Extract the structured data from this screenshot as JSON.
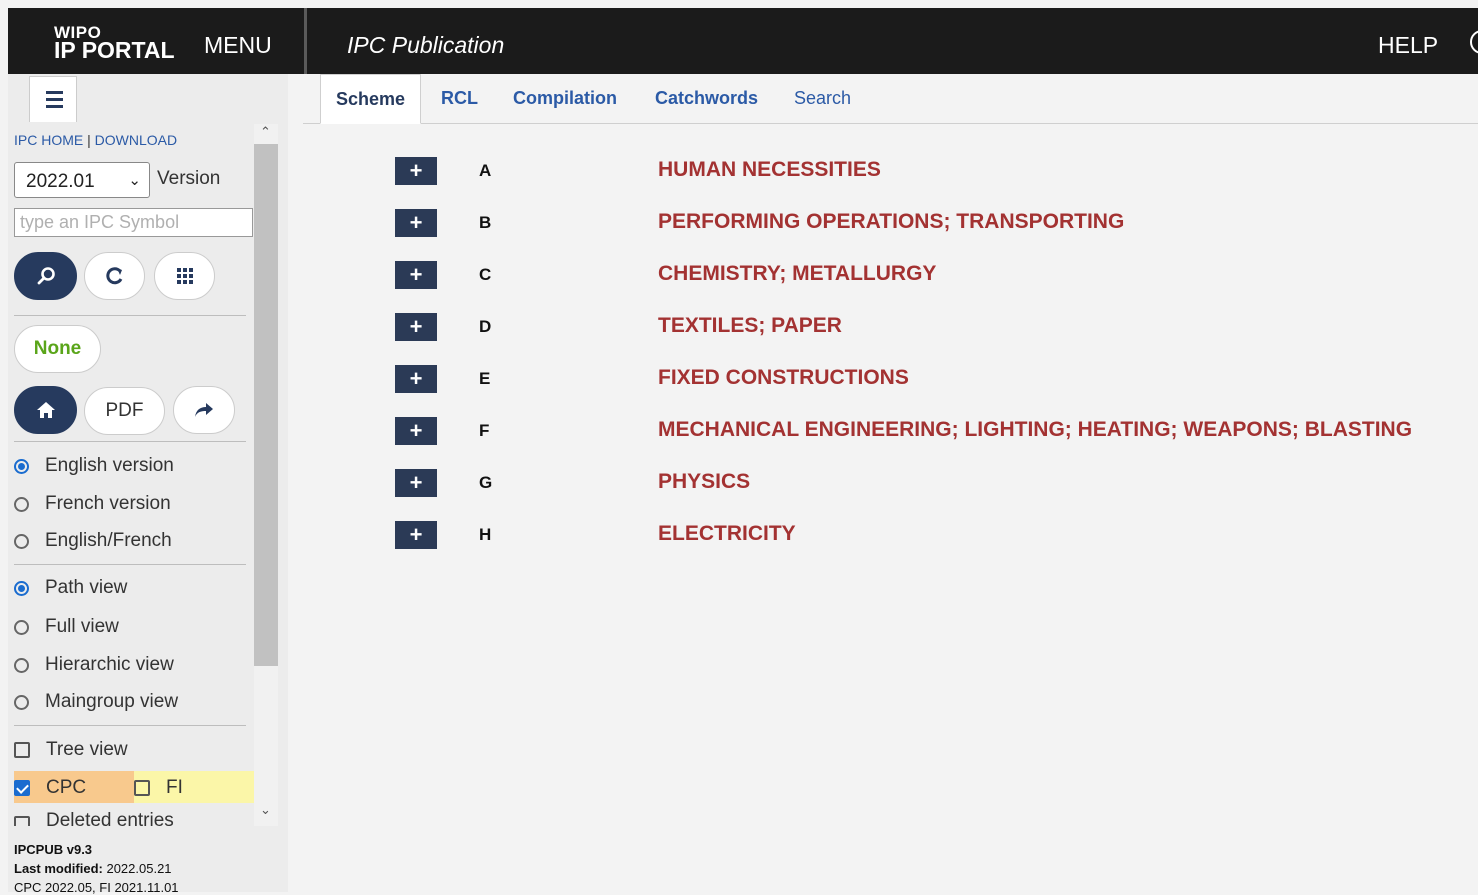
{
  "header": {
    "logo_line1": "WIPO",
    "logo_line2": "IP PORTAL",
    "menu_label": "MENU",
    "title": "IPC Publication",
    "help_label": "HELP"
  },
  "sidebar": {
    "link_home": "IPC HOME",
    "link_separator": "|",
    "link_download": "DOWNLOAD",
    "version_value": "2022.01",
    "version_label": "Version",
    "symbol_placeholder": "type an IPC Symbol",
    "none_label": "None",
    "pdf_label": "PDF",
    "language_options": [
      {
        "label": "English version",
        "selected": true
      },
      {
        "label": "French version",
        "selected": false
      },
      {
        "label": "English/French",
        "selected": false
      }
    ],
    "view_options": [
      {
        "label": "Path view",
        "selected": true
      },
      {
        "label": "Full view",
        "selected": false
      },
      {
        "label": "Hierarchic view",
        "selected": false
      },
      {
        "label": "Maingroup view",
        "selected": false
      }
    ],
    "tree_view_label": "Tree view",
    "cpc_label": "CPC",
    "fi_label": "FI",
    "deleted_entries_label": "Deleted entries"
  },
  "footer": {
    "version_line": "IPCPUB v9.3",
    "last_modified_label": "Last modified:",
    "last_modified_value": "2022.05.21",
    "cpc_fi_line": "CPC 2022.05, FI 2021.11.01"
  },
  "tabs": [
    "Scheme",
    "RCL",
    "Compilation",
    "Catchwords",
    "Search"
  ],
  "sections": [
    {
      "letter": "A",
      "title": "HUMAN NECESSITIES"
    },
    {
      "letter": "B",
      "title": "PERFORMING OPERATIONS; TRANSPORTING"
    },
    {
      "letter": "C",
      "title": "CHEMISTRY; METALLURGY"
    },
    {
      "letter": "D",
      "title": "TEXTILES; PAPER"
    },
    {
      "letter": "E",
      "title": "FIXED CONSTRUCTIONS"
    },
    {
      "letter": "F",
      "title": "MECHANICAL ENGINEERING; LIGHTING; HEATING; WEAPONS; BLASTING"
    },
    {
      "letter": "G",
      "title": "PHYSICS"
    },
    {
      "letter": "H",
      "title": "ELECTRICITY"
    }
  ],
  "icons": {
    "expand": "+",
    "search": "search-icon",
    "refresh": "refresh-icon",
    "grid": "grid-icon",
    "home": "home-icon",
    "share": "share-arrow-icon"
  }
}
